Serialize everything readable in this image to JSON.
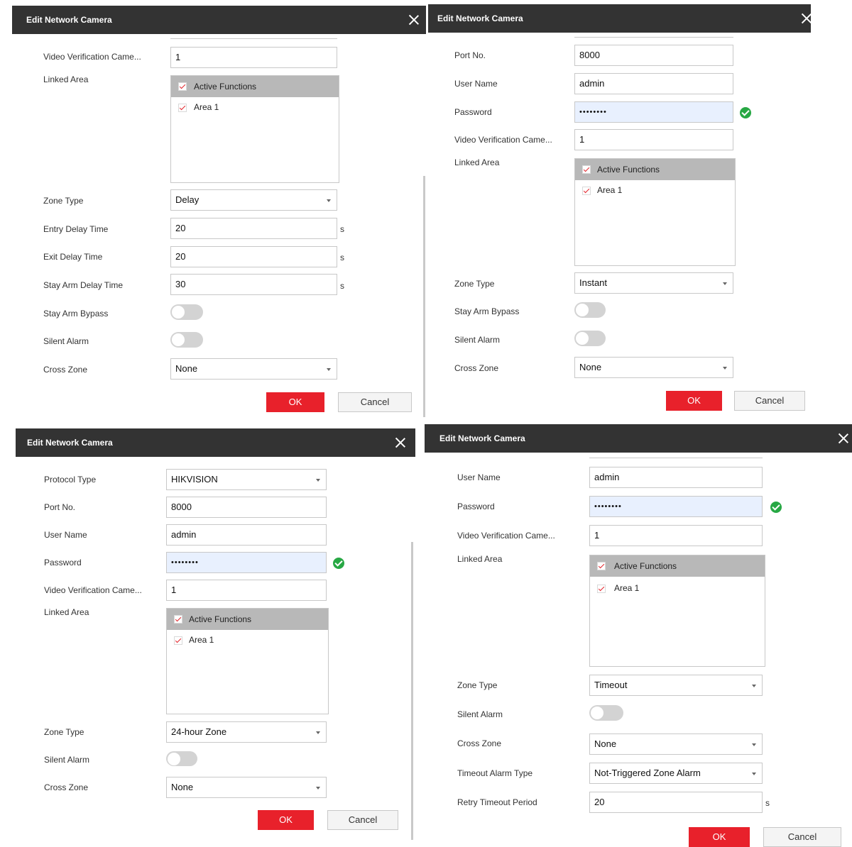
{
  "dialog_title": "Edit Network Camera",
  "labels": {
    "protocol_type": "Protocol Type",
    "port_no": "Port No.",
    "user_name": "User Name",
    "password": "Password",
    "video_verification_camera": "Video Verification Came...",
    "linked_area": "Linked Area",
    "zone_type": "Zone Type",
    "entry_delay_time": "Entry Delay Time",
    "exit_delay_time": "Exit Delay Time",
    "stay_arm_delay_time": "Stay Arm Delay Time",
    "stay_arm_bypass": "Stay Arm Bypass",
    "silent_alarm": "Silent Alarm",
    "cross_zone": "Cross Zone",
    "timeout_alarm_type": "Timeout Alarm Type",
    "retry_timeout_period": "Retry Timeout Period"
  },
  "linked_area": {
    "header": "Active Functions",
    "item": "Area 1"
  },
  "unit_seconds": "s",
  "buttons": {
    "ok": "OK",
    "cancel": "Cancel"
  },
  "panel_delay": {
    "video_verification_camera": "1",
    "zone_type": "Delay",
    "entry_delay_time": "20",
    "exit_delay_time": "20",
    "stay_arm_delay_time": "30",
    "stay_arm_bypass": false,
    "silent_alarm": false,
    "cross_zone": "None"
  },
  "panel_instant": {
    "port_no": "8000",
    "user_name": "admin",
    "password": "••••••••",
    "video_verification_camera": "1",
    "zone_type": "Instant",
    "stay_arm_bypass": false,
    "silent_alarm": false,
    "cross_zone": "None"
  },
  "panel_24h": {
    "protocol_type": "HIKVISION",
    "port_no": "8000",
    "user_name": "admin",
    "password": "••••••••",
    "video_verification_camera": "1",
    "zone_type": "24-hour Zone",
    "silent_alarm": false,
    "cross_zone": "None"
  },
  "panel_timeout": {
    "user_name": "admin",
    "password": "••••••••",
    "video_verification_camera": "1",
    "zone_type": "Timeout",
    "silent_alarm": false,
    "cross_zone": "None",
    "timeout_alarm_type": "Not-Triggered Zone Alarm",
    "retry_timeout_period": "20"
  }
}
